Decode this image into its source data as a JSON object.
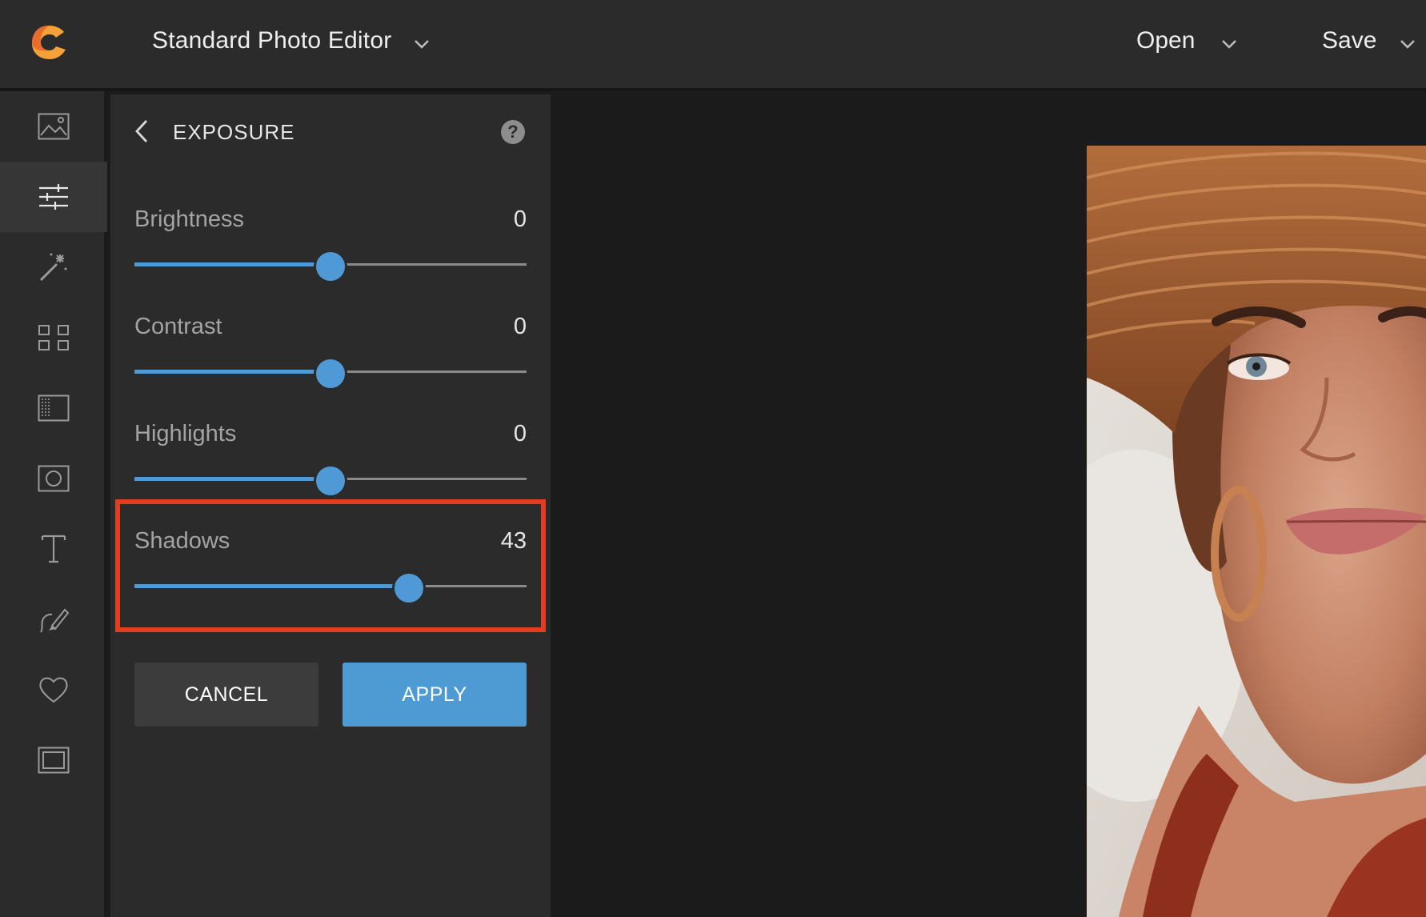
{
  "header": {
    "app_name": "Standard Photo Editor",
    "open_label": "Open",
    "save_label": "Save"
  },
  "rail": {
    "items": [
      {
        "name": "image",
        "icon": "image-icon",
        "active": false
      },
      {
        "name": "adjust",
        "icon": "sliders-icon",
        "active": true
      },
      {
        "name": "effects",
        "icon": "magic-wand-icon",
        "active": false
      },
      {
        "name": "templates",
        "icon": "grid-icon",
        "active": false
      },
      {
        "name": "textures",
        "icon": "texture-icon",
        "active": false
      },
      {
        "name": "vignette",
        "icon": "vignette-icon",
        "active": false
      },
      {
        "name": "text",
        "icon": "text-icon",
        "active": false
      },
      {
        "name": "draw",
        "icon": "brush-icon",
        "active": false
      },
      {
        "name": "stickers",
        "icon": "heart-icon",
        "active": false
      },
      {
        "name": "frames",
        "icon": "frame-icon",
        "active": false
      }
    ]
  },
  "panel": {
    "title": "EXPOSURE",
    "help_glyph": "?",
    "adjustments": [
      {
        "label": "Brightness",
        "value": "0",
        "position": 0.5
      },
      {
        "label": "Contrast",
        "value": "0",
        "position": 0.5
      },
      {
        "label": "Highlights",
        "value": "0",
        "position": 0.5
      },
      {
        "label": "Shadows",
        "value": "43",
        "position": 0.7
      }
    ],
    "cancel_label": "CANCEL",
    "apply_label": "APPLY"
  },
  "colors": {
    "accent": "#4f9ad6",
    "highlight": "#e33b24",
    "panel_bg": "#2b2b2b",
    "canvas_bg": "#1b1b1b"
  }
}
